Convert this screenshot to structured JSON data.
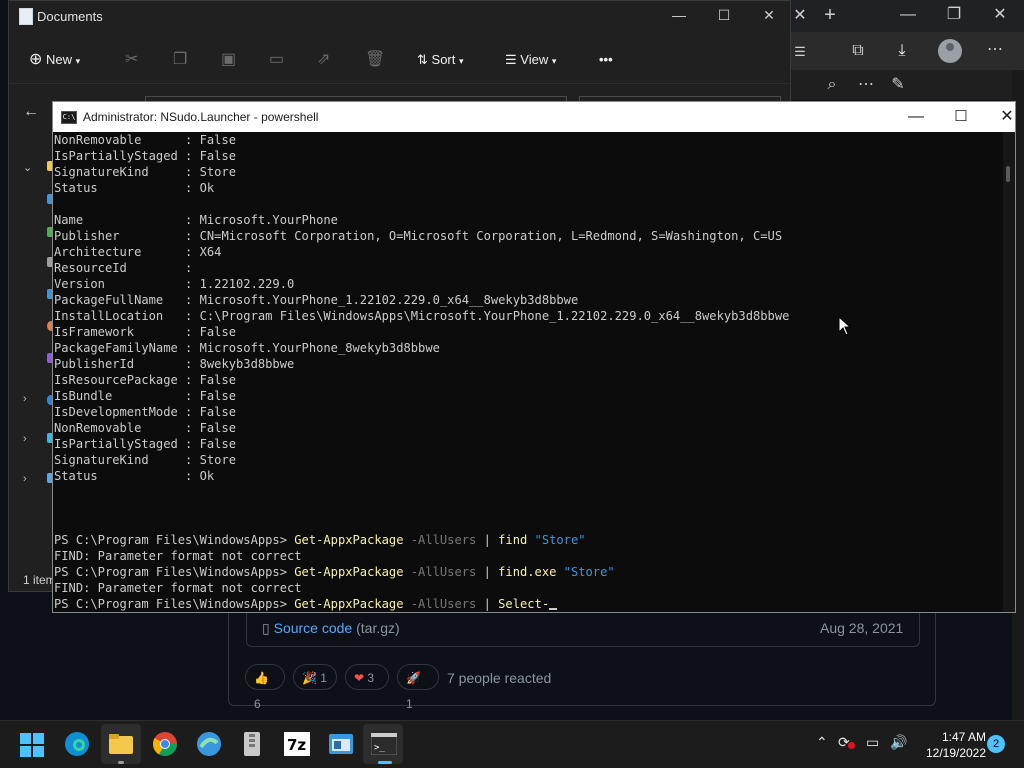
{
  "explorer": {
    "title": "Documents",
    "new_label": "New",
    "sort_label": "Sort",
    "view_label": "View",
    "more_label": "•••",
    "status": "1 item"
  },
  "powershell": {
    "title": "Administrator: NSudo.Launcher - powershell",
    "lines": [
      {
        "t": "NonRemovable      : False"
      },
      {
        "t": "IsPartiallyStaged : False"
      },
      {
        "t": "SignatureKind     : Store"
      },
      {
        "t": "Status            : Ok"
      },
      {
        "t": ""
      },
      {
        "t": "Name              : Microsoft.YourPhone"
      },
      {
        "t": "Publisher         : CN=Microsoft Corporation, O=Microsoft Corporation, L=Redmond, S=Washington, C=US"
      },
      {
        "t": "Architecture      : X64"
      },
      {
        "t": "ResourceId        :"
      },
      {
        "t": "Version           : 1.22102.229.0"
      },
      {
        "t": "PackageFullName   : Microsoft.YourPhone_1.22102.229.0_x64__8wekyb3d8bbwe"
      },
      {
        "t": "InstallLocation   : C:\\Program Files\\WindowsApps\\Microsoft.YourPhone_1.22102.229.0_x64__8wekyb3d8bbwe"
      },
      {
        "t": "IsFramework       : False"
      },
      {
        "t": "PackageFamilyName : Microsoft.YourPhone_8wekyb3d8bbwe"
      },
      {
        "t": "PublisherId       : 8wekyb3d8bbwe"
      },
      {
        "t": "IsResourcePackage : False"
      },
      {
        "t": "IsBundle          : False"
      },
      {
        "t": "IsDevelopmentMode : False"
      },
      {
        "t": "NonRemovable      : False"
      },
      {
        "t": "IsPartiallyStaged : False"
      },
      {
        "t": "SignatureKind     : Store"
      },
      {
        "t": "Status            : Ok"
      },
      {
        "t": ""
      },
      {
        "t": ""
      },
      {
        "t": ""
      },
      {
        "prompt": "PS C:\\Program Files\\WindowsApps> ",
        "cmd": "Get-AppxPackage",
        "param": " -AllUsers",
        "pipe": " | ",
        "cmd2": "find",
        "str": " \"Store\""
      },
      {
        "t": "FIND: Parameter format not correct"
      },
      {
        "prompt": "PS C:\\Program Files\\WindowsApps> ",
        "cmd": "Get-AppxPackage",
        "param": " -AllUsers",
        "pipe": " | ",
        "cmd2": "find.exe",
        "str": " \"Store\""
      },
      {
        "t": "FIND: Parameter format not correct"
      },
      {
        "prompt": "PS C:\\Program Files\\WindowsApps> ",
        "cmd": "Get-AppxPackage",
        "param": " -AllUsers",
        "pipe": " | ",
        "cmd2": "Select-",
        "str": "",
        "cursor": true
      }
    ]
  },
  "browser": {
    "source_link": "Source code",
    "source_ext": "(tar.gz)",
    "source_date": "Aug 28, 2021",
    "reactions": [
      {
        "emoji": "👍",
        "count": "6"
      },
      {
        "emoji": "🎉",
        "count": "1"
      },
      {
        "emoji": "❤",
        "count": "3"
      },
      {
        "emoji": "🚀",
        "count": "1"
      }
    ],
    "reacted_text": "7 people reacted"
  },
  "taskbar": {
    "time": "1:47 AM",
    "date": "12/19/2022",
    "notification_count": "2"
  }
}
